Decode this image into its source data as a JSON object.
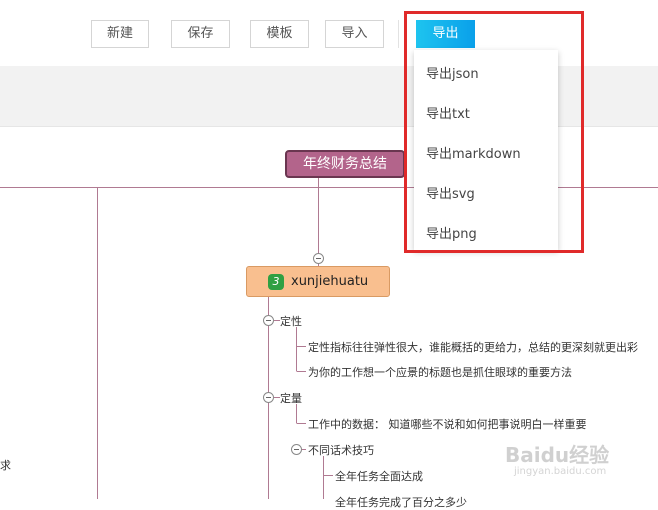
{
  "toolbar": {
    "new_label": "新建",
    "save_label": "保存",
    "template_label": "模板",
    "import_label": "导入",
    "export_label": "导出"
  },
  "export_menu": {
    "items": [
      "导出json",
      "导出txt",
      "导出markdown",
      "导出svg",
      "导出png"
    ]
  },
  "mindmap": {
    "root": "年终财务总结",
    "main_node": {
      "badge": "3",
      "label": "xunjiehuatu"
    },
    "branches": [
      {
        "label": "定性",
        "children": [
          "定性指标往往弹性很大，谁能概括的更给力，总结的更深刻就更出彩",
          "为你的工作想一个应景的标题也是抓住眼球的重要方法"
        ]
      },
      {
        "label": "定量",
        "children": [
          "工作中的数据： 知道哪些不说和如何把事说明白一样重要"
        ]
      },
      {
        "label": "不同话术技巧",
        "children": [
          "全年任务全面达成",
          "全年任务完成了百分之多少"
        ]
      }
    ],
    "left_edge_text": "求"
  },
  "watermark": {
    "text": "Baidu经验",
    "sub": "jingyan.baidu.com"
  }
}
